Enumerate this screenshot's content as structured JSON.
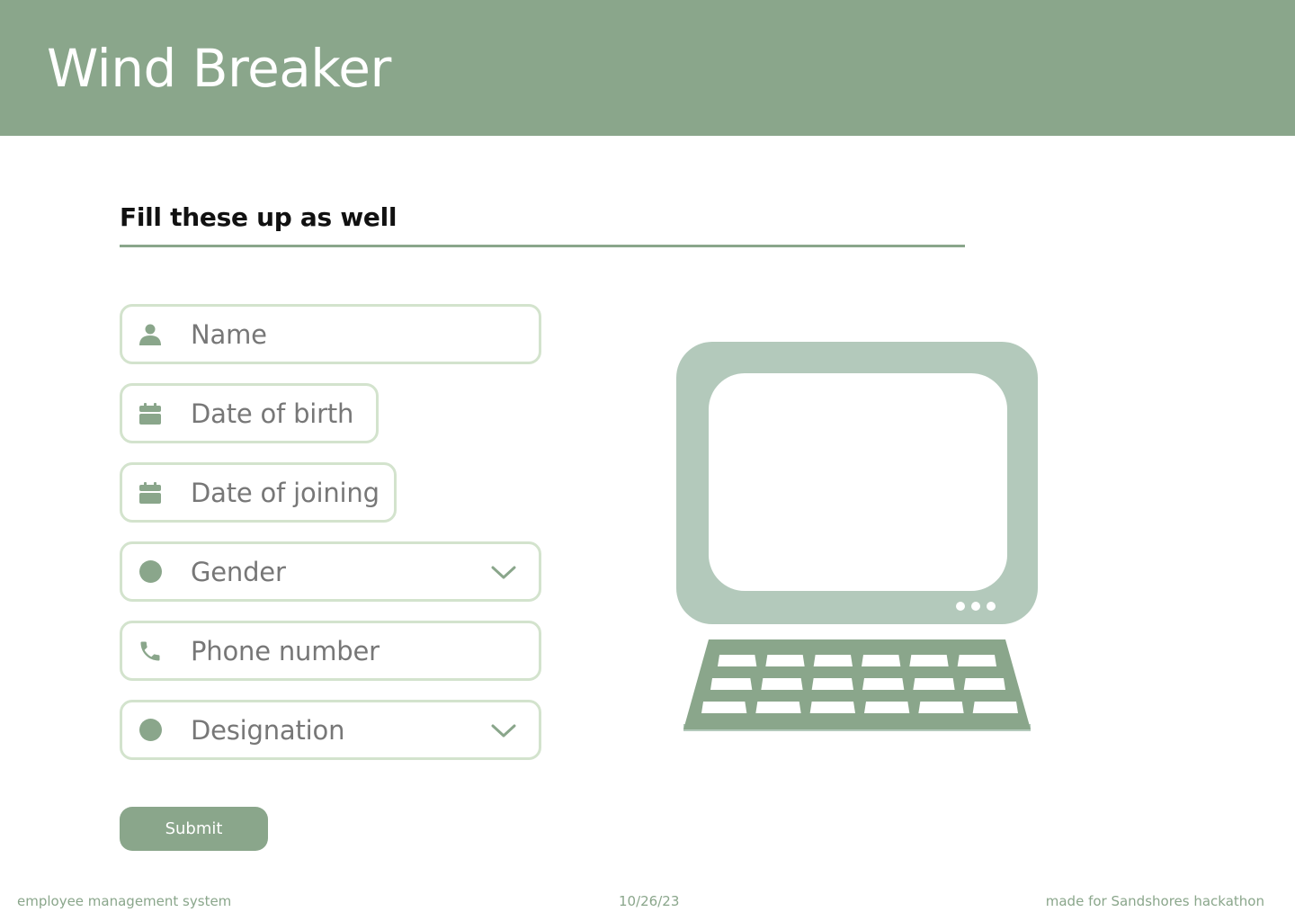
{
  "app": {
    "title": "Wind Breaker"
  },
  "form": {
    "section_title": "Fill these up as well",
    "fields": {
      "name": {
        "label": "Name",
        "icon": "person-icon"
      },
      "dob": {
        "label": "Date of birth",
        "icon": "calendar-icon"
      },
      "doj": {
        "label": "Date of joining",
        "icon": "calendar-icon"
      },
      "gender": {
        "label": "Gender",
        "icon": "circle-icon"
      },
      "phone": {
        "label": "Phone number",
        "icon": "phone-icon"
      },
      "designation": {
        "label": "Designation",
        "icon": "circle-icon"
      }
    },
    "submit_label": "Submit"
  },
  "footer": {
    "left": "employee management system",
    "center": "10/26/23",
    "right": "made for Sandshores hackathon"
  },
  "colors": {
    "accent": "#8aa68b",
    "field_border": "#d3e3cd",
    "monitor": "#b3c9bb",
    "label_text": "#777777"
  }
}
